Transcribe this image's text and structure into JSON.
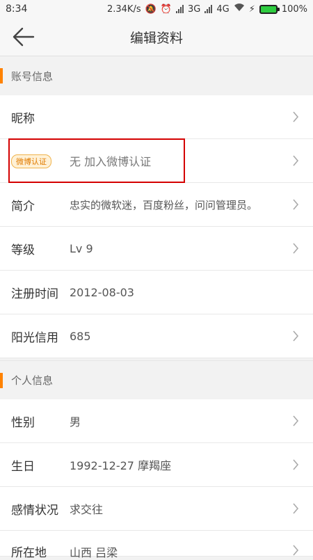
{
  "status_bar": {
    "time": "8:34",
    "speed": "2.34K/s",
    "net_3g": "3G",
    "net_4g": "4G",
    "battery": "100%",
    "icons": [
      "mute-icon",
      "alarm-icon",
      "signal-icon",
      "signal-icon",
      "wifi-icon",
      "charging-icon",
      "battery-icon"
    ]
  },
  "topbar": {
    "title": "编辑资料",
    "back_icon": "back-arrow-icon"
  },
  "accent_color": "#ff8200",
  "sections": {
    "account": {
      "header": "账号信息",
      "rows": [
        {
          "key": "昵称",
          "value": ""
        },
        {
          "badge": "微博认证",
          "value": "无 加入微博认证"
        },
        {
          "key": "简介",
          "value": "忠实的微软迷，百度粉丝，问问管理员。"
        },
        {
          "key": "等级",
          "value": "Lv 9"
        },
        {
          "key": "注册时间",
          "value": "2012-08-03"
        },
        {
          "key": "阳光信用",
          "value": "685"
        }
      ]
    },
    "personal": {
      "header": "个人信息",
      "rows": [
        {
          "key": "性别",
          "value": "男"
        },
        {
          "key": "生日",
          "value": "1992-12-27 摩羯座"
        },
        {
          "key": "感情状况",
          "value": "求交往"
        },
        {
          "key": "所在地",
          "value": "山西 吕梁"
        }
      ]
    }
  }
}
